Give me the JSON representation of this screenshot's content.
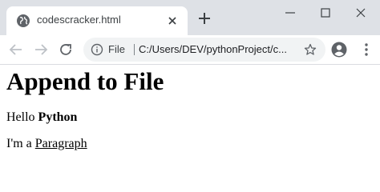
{
  "tab": {
    "title": "codescracker.html",
    "favicon_icon": "globe-icon",
    "close_icon": "close-icon"
  },
  "new_tab_icon": "plus-icon",
  "window_controls": [
    "minimize-icon",
    "maximize-icon",
    "close-icon"
  ],
  "toolbar": {
    "back_icon": "arrow-left-icon",
    "forward_icon": "arrow-right-icon",
    "reload_icon": "reload-icon",
    "scheme_icon": "info-icon",
    "scheme_label": "File",
    "url": "C:/Users/DEV/pythonProject/c...",
    "bookmark_icon": "star-icon",
    "profile_icon": "account-circle-icon",
    "menu_icon": "kebab-menu-icon"
  },
  "page": {
    "heading": "Append to File",
    "para1_prefix": "Hello ",
    "para1_bold": "Python",
    "para2_prefix": "I'm a ",
    "para2_link": "Paragraph"
  },
  "colors": {
    "titlebar_bg": "#dee1e6",
    "omnibox_bg": "#f1f3f4",
    "icon_gray": "#5f6368"
  }
}
